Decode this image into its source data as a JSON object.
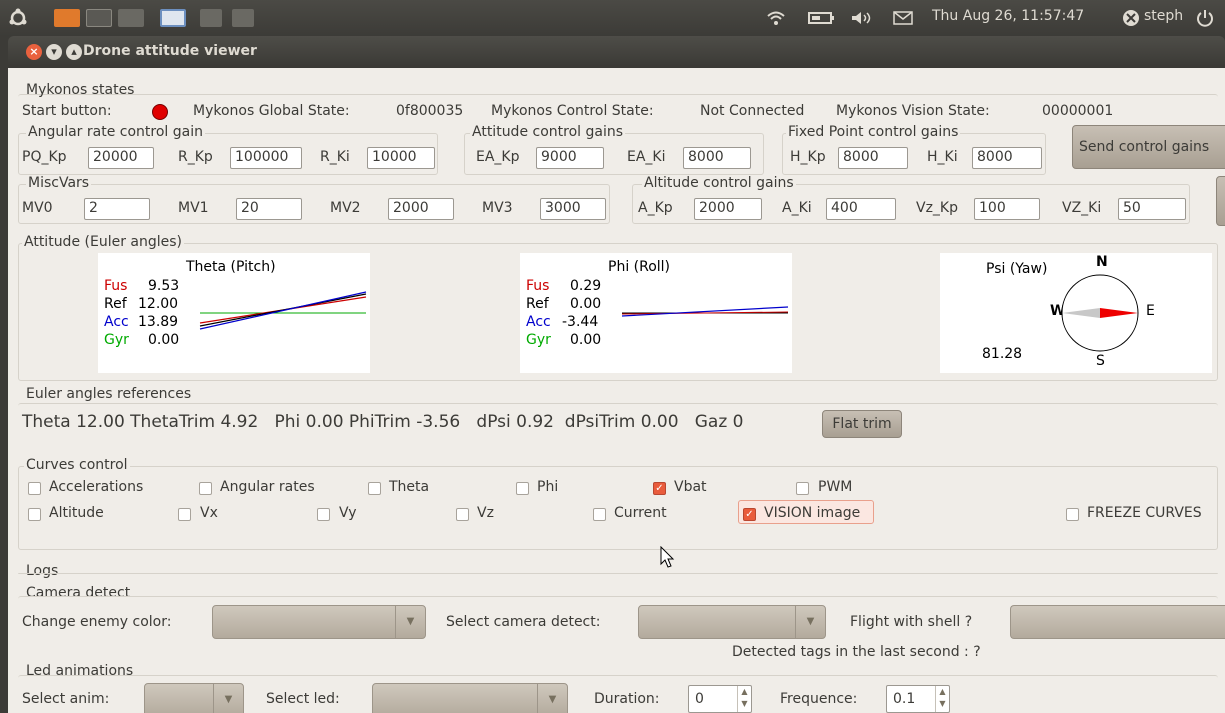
{
  "top_panel": {
    "datetime": "Thu Aug 26, 11:57:47",
    "user": "steph"
  },
  "window": {
    "title": "Drone attitude viewer"
  },
  "states": {
    "title": "Mykonos states",
    "start_label": "Start button:",
    "global_label": "Mykonos Global State:",
    "global_value": "0f800035",
    "control_label": "Mykonos Control State:",
    "control_value": "Not Connected",
    "vision_label": "Mykonos Vision State:",
    "vision_value": "00000001"
  },
  "angular_gain": {
    "title": "Angular rate control gain",
    "pq_kp_label": "PQ_Kp",
    "pq_kp": "20000",
    "r_kp_label": "R_Kp",
    "r_kp": "100000",
    "r_ki_label": "R_Ki",
    "r_ki": "10000"
  },
  "attitude_gain": {
    "title": "Attitude control gains",
    "ea_kp_label": "EA_Kp",
    "ea_kp": "9000",
    "ea_ki_label": "EA_Ki",
    "ea_ki": "8000"
  },
  "fixed_gain": {
    "title": "Fixed Point control gains",
    "h_kp_label": "H_Kp",
    "h_kp": "8000",
    "h_ki_label": "H_Ki",
    "h_ki": "8000"
  },
  "send_button": "Send control gains",
  "miscvars": {
    "title": "MiscVars",
    "mv0_label": "MV0",
    "mv0": "2",
    "mv1_label": "MV1",
    "mv1": "20",
    "mv2_label": "MV2",
    "mv2": "2000",
    "mv3_label": "MV3",
    "mv3": "3000"
  },
  "altitude_gain": {
    "title": "Altitude control gains",
    "a_kp_label": "A_Kp",
    "a_kp": "2000",
    "a_ki_label": "A_Ki",
    "a_ki": "400",
    "vz_kp_label": "Vz_Kp",
    "vz_kp": "100",
    "vz_ki_label": "VZ_Ki",
    "vz_ki": "50"
  },
  "attitude": {
    "title": "Attitude (Euler angles)",
    "theta": {
      "title": "Theta (Pitch)",
      "fus_label": "Fus",
      "fus": "9.53",
      "ref_label": "Ref",
      "ref": "12.00",
      "acc_label": "Acc",
      "acc": "13.89",
      "gyr_label": "Gyr",
      "gyr": "0.00"
    },
    "phi": {
      "title": "Phi (Roll)",
      "fus_label": "Fus",
      "fus": "0.29",
      "ref_label": "Ref",
      "ref": "0.00",
      "acc_label": "Acc",
      "acc": "-3.44",
      "gyr_label": "Gyr",
      "gyr": "0.00"
    },
    "psi": {
      "title": "Psi (Yaw)",
      "value": "81.28",
      "n": "N",
      "e": "E",
      "s": "S",
      "w": "W"
    },
    "colors": {
      "fus": "#cc0000",
      "ref": "#000000",
      "acc": "#0000cc",
      "gyr": "#00aa00"
    }
  },
  "euler_refs": {
    "title": "Euler angles references",
    "text": "Theta 12.00 ThetaTrim 4.92   Phi 0.00 PhiTrim -3.56   dPsi 0.92  dPsiTrim 0.00   Gaz 0",
    "flat_trim": "Flat trim"
  },
  "curves": {
    "title": "Curves control",
    "accelerations": "Accelerations",
    "angular_rates": "Angular rates",
    "theta": "Theta",
    "phi": "Phi",
    "vbat": "Vbat",
    "pwm": "PWM",
    "altitude": "Altitude",
    "vx": "Vx",
    "vy": "Vy",
    "vz": "Vz",
    "current": "Current",
    "vision": "VISION image",
    "freeze": "FREEZE CURVES"
  },
  "logs": {
    "title": "Logs"
  },
  "camera": {
    "title": "Camera detect",
    "enemy_label": "Change enemy color:",
    "detect_label": "Select camera detect:",
    "shell_label": "Flight with shell ?",
    "tags_text": "Detected tags in the last second : ?"
  },
  "led": {
    "title": "Led animations",
    "anim_label": "Select anim:",
    "led_label": "Select led:",
    "duration_label": "Duration:",
    "duration": "0",
    "freq_label": "Frequence:",
    "freq": "0.1"
  }
}
